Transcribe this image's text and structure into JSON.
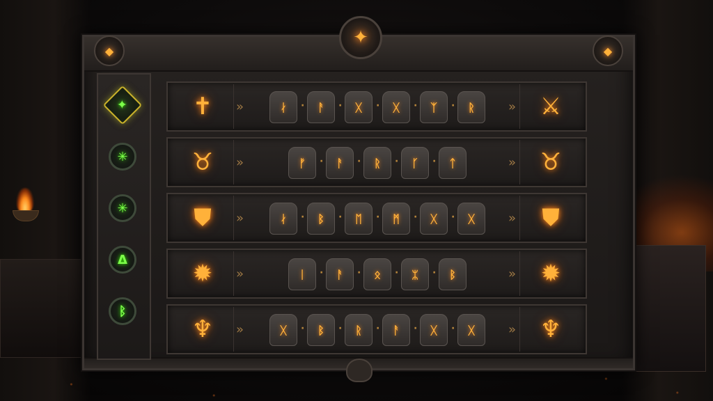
{
  "crest_icon": "compass-star-icon",
  "corner_icons": [
    "ember-gem-icon",
    "ember-gem-icon"
  ],
  "sidebar": {
    "categories": [
      {
        "icon": "compass-glyph-icon",
        "glyph": "✦",
        "active": true
      },
      {
        "icon": "compass-glyph-icon",
        "glyph": "✳",
        "active": false
      },
      {
        "icon": "compass-glyph-icon",
        "glyph": "✳",
        "active": false
      },
      {
        "icon": "triangle-rune-icon",
        "glyph": "Δ",
        "active": false
      },
      {
        "icon": "b-rune-icon",
        "glyph": "ᛒ",
        "active": false
      }
    ]
  },
  "recipes": [
    {
      "input_icon": "dagger-cross-icon",
      "input_glyph": "✝",
      "runes": [
        "ᛅ",
        "ᚨ",
        "ᚷ",
        "ᚷ",
        "ᛉ",
        "ᚱ"
      ],
      "output_icon": "sword-icon",
      "output_glyph": "⚔"
    },
    {
      "input_icon": "horned-helm-icon",
      "input_glyph": "♉",
      "runes": [
        "ᚠ",
        "ᚨ",
        "ᚱ",
        "ᚴ",
        "ᛏ"
      ],
      "output_icon": "horned-helm-icon",
      "output_glyph": "♉"
    },
    {
      "input_icon": "shield-icon",
      "input_glyph": "⛊",
      "runes": [
        "ᛅ",
        "ᛒ",
        "ᛖ",
        "ᛗ",
        "ᚷ",
        "ᚷ"
      ],
      "output_icon": "shield-icon",
      "output_glyph": "⛊"
    },
    {
      "input_icon": "sunburst-icon",
      "input_glyph": "✹",
      "runes": [
        "ᛁ",
        "ᚨ",
        "ᛟ",
        "ᛯ",
        "ᛒ"
      ],
      "output_icon": "sunburst-icon",
      "output_glyph": "✹"
    },
    {
      "input_icon": "trident-icon",
      "input_glyph": "♆",
      "runes": [
        "ᚷ",
        "ᛒ",
        "ᚱ",
        "ᚨ",
        "ᚷ",
        "ᚷ"
      ],
      "output_icon": "trident-icon",
      "output_glyph": "♆"
    }
  ],
  "arrow_glyph": "»",
  "colors": {
    "ember": "#ffb13a",
    "nature": "#7dff4a",
    "stone": "#3e3733"
  }
}
